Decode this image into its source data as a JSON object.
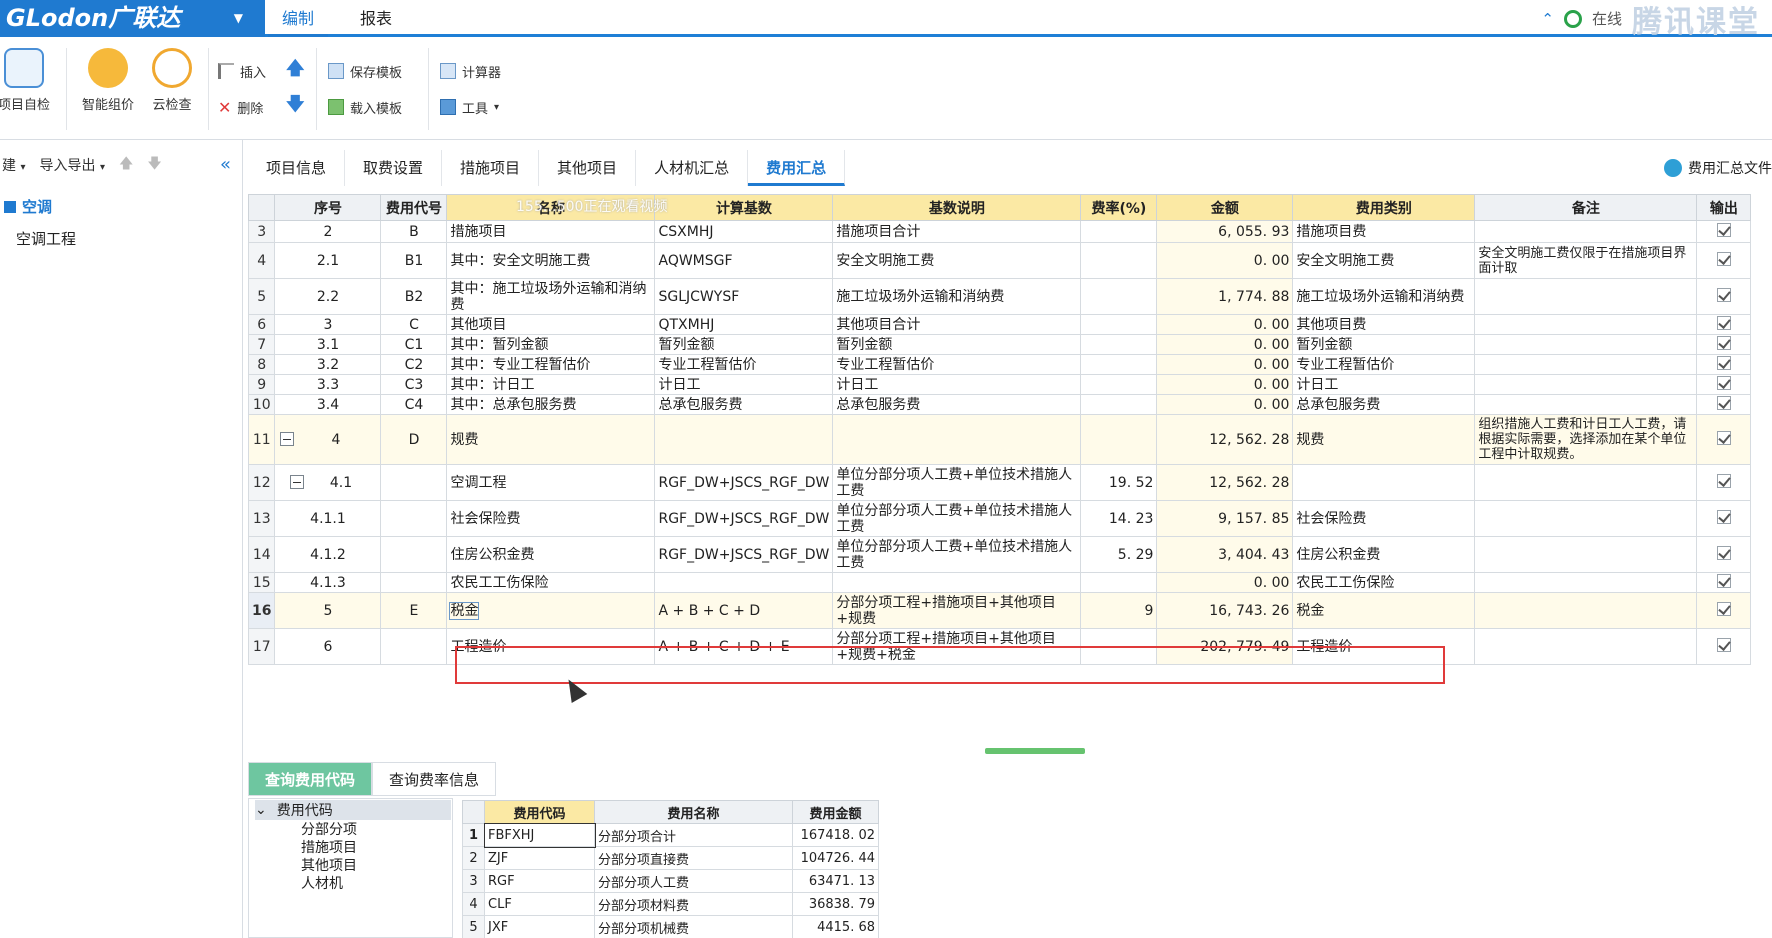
{
  "app": {
    "logo": "GLodon广联达",
    "menu": [
      "编制",
      "报表"
    ],
    "online_label": "在线",
    "watermark": "腾讯课堂"
  },
  "ribbon": {
    "big": [
      "项目自检",
      "智能组价",
      "云检查"
    ],
    "insert": "插入",
    "delete": "删除",
    "save_template": "保存模板",
    "load_template": "载入模板",
    "calculator": "计算器",
    "tools": "工具"
  },
  "left": {
    "new_label": "建",
    "import_export": "导入导出",
    "tree_root": "空调",
    "tree_child": "空调工程"
  },
  "tabs": [
    "项目信息",
    "取费设置",
    "措施项目",
    "其他项目",
    "人材机汇总",
    "费用汇总"
  ],
  "tab_right": "费用汇总文件",
  "overlay": "155…500正在观看视频",
  "table": {
    "headers": [
      "序号",
      "费用代号",
      "名称",
      "计算基数",
      "基数说明",
      "费率(%)",
      "金额",
      "费用类别",
      "备注",
      "输出"
    ],
    "rows": [
      {
        "n": "3",
        "seq": "2",
        "code": "B",
        "name": "措施项目",
        "base": "CSXMHJ",
        "desc": "措施项目合计",
        "rate": "",
        "amt": "6, 055. 93",
        "cat": "措施项目费",
        "note": ""
      },
      {
        "n": "4",
        "seq": "2.1",
        "code": "B1",
        "name": " 其中：安全文明施工费",
        "base": "AQWMSGF",
        "desc": "安全文明施工费",
        "rate": "",
        "amt": "0. 00",
        "cat": "安全文明施工费",
        "note": "安全文明施工费仅限于在措施项目界面计取"
      },
      {
        "n": "5",
        "seq": "2.2",
        "code": "B2",
        "name": " 其中：施工垃圾场外运输和消纳费",
        "base": "SGLJCWYSF",
        "desc": "施工垃圾场外运输和消纳费",
        "rate": "",
        "amt": "1, 774. 88",
        "cat": "施工垃圾场外运输和消纳费",
        "note": ""
      },
      {
        "n": "6",
        "seq": "3",
        "code": "C",
        "name": "其他项目",
        "base": "QTXMHJ",
        "desc": "其他项目合计",
        "rate": "",
        "amt": "0. 00",
        "cat": "其他项目费",
        "note": ""
      },
      {
        "n": "7",
        "seq": "3.1",
        "code": "C1",
        "name": " 其中：暂列金额",
        "base": "暂列金额",
        "desc": "暂列金额",
        "rate": "",
        "amt": "0. 00",
        "cat": "暂列金额",
        "note": ""
      },
      {
        "n": "8",
        "seq": "3.2",
        "code": "C2",
        "name": " 其中：专业工程暂估价",
        "base": "专业工程暂估价",
        "desc": "专业工程暂估价",
        "rate": "",
        "amt": "0. 00",
        "cat": "专业工程暂估价",
        "note": ""
      },
      {
        "n": "9",
        "seq": "3.3",
        "code": "C3",
        "name": " 其中：计日工",
        "base": "计日工",
        "desc": "计日工",
        "rate": "",
        "amt": "0. 00",
        "cat": "计日工",
        "note": ""
      },
      {
        "n": "10",
        "seq": "3.4",
        "code": "C4",
        "name": " 其中：总承包服务费",
        "base": "总承包服务费",
        "desc": "总承包服务费",
        "rate": "",
        "amt": "0. 00",
        "cat": "总承包服务费",
        "note": ""
      },
      {
        "n": "11",
        "seq": "4",
        "code": "D",
        "name": "规费",
        "base": "",
        "desc": "",
        "rate": "",
        "amt": "12, 562. 28",
        "cat": "规费",
        "note": "组织措施人工费和计日工人工费，请根据实际需要，选择添加在某个单位工程中计取规费。"
      },
      {
        "n": "12",
        "seq": "4.1",
        "code": "",
        "name": "空调工程",
        "base": "RGF_DW+JSCS_RGF_DW",
        "desc": "单位分部分项人工费+单位技术措施人工费",
        "rate": "19. 52",
        "amt": "12, 562. 28",
        "cat": "",
        "note": ""
      },
      {
        "n": "13",
        "seq": "4.1.1",
        "code": "",
        "name": "社会保险费",
        "base": "RGF_DW+JSCS_RGF_DW",
        "desc": "单位分部分项人工费+单位技术措施人工费",
        "rate": "14. 23",
        "amt": "9, 157. 85",
        "cat": "社会保险费",
        "note": ""
      },
      {
        "n": "14",
        "seq": "4.1.2",
        "code": "",
        "name": "住房公积金费",
        "base": "RGF_DW+JSCS_RGF_DW",
        "desc": "单位分部分项人工费+单位技术措施人工费",
        "rate": "5. 29",
        "amt": "3, 404. 43",
        "cat": "住房公积金费",
        "note": ""
      },
      {
        "n": "15",
        "seq": "4.1.3",
        "code": "",
        "name": "农民工工伤保险",
        "base": "",
        "desc": "",
        "rate": "",
        "amt": "0. 00",
        "cat": "农民工工伤保险",
        "note": ""
      },
      {
        "n": "16",
        "seq": "5",
        "code": "E",
        "name": "税金",
        "base": "A + B + C + D",
        "desc": "分部分项工程+措施项目+其他项目+规费",
        "rate": "9",
        "amt": "16, 743. 26",
        "cat": "税金",
        "note": ""
      },
      {
        "n": "17",
        "seq": "6",
        "code": "",
        "name": "工程造价",
        "base": "A + B + C + D + E",
        "desc": "分部分项工程+措施项目+其他项目+规费+税金",
        "rate": "",
        "amt": "202, 779. 49",
        "cat": "工程造价",
        "note": ""
      }
    ]
  },
  "bottom": {
    "tabs": [
      "查询费用代码",
      "查询费率信息"
    ],
    "tree_root": "费用代码",
    "tree_nodes": [
      "分部分项",
      "措施项目",
      "其他项目",
      "人材机"
    ],
    "headers": [
      "费用代码",
      "费用名称",
      "费用金额"
    ],
    "rows": [
      {
        "n": "1",
        "code": "FBFXHJ",
        "name": "分部分项合计",
        "amt": "167418. 02"
      },
      {
        "n": "2",
        "code": "ZJF",
        "name": "分部分项直接费",
        "amt": "104726. 44"
      },
      {
        "n": "3",
        "code": "RGF",
        "name": "分部分项人工费",
        "amt": "63471. 13"
      },
      {
        "n": "4",
        "code": "CLF",
        "name": "分部分项材料费",
        "amt": "36838. 79"
      },
      {
        "n": "5",
        "code": "JXF",
        "name": "分部分项机械费",
        "amt": "4415. 68"
      }
    ]
  },
  "colors": {
    "accent": "#1f7ad0",
    "header_highlight": "#fbe9a4",
    "selection": "#e03a3a",
    "bottom_tab": "#6ec6a0"
  }
}
